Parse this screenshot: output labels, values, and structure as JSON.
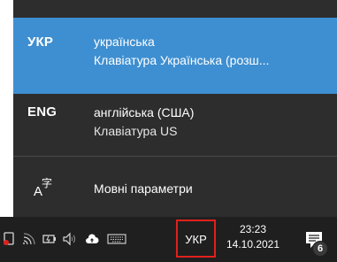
{
  "languages": [
    {
      "code": "УКР",
      "name": "українська",
      "keyboard": "Клавіатура Українська (розш...",
      "selected": true
    },
    {
      "code": "ENG",
      "name": "англійська (США)",
      "keyboard": "Клавіатура US",
      "selected": false
    }
  ],
  "settings": {
    "label": "Мовні параметри",
    "icon": "language-settings-icon"
  },
  "taskbar": {
    "input_indicator": "УКР",
    "time": "23:23",
    "date": "14.10.2021",
    "notification_count": "6",
    "tray_icons": [
      "antivirus-icon",
      "network-icon",
      "battery-icon",
      "volume-icon",
      "cloud-icon",
      "keyboard-icon"
    ]
  },
  "colors": {
    "accent": "#3e8fd1",
    "flyout_bg": "#2d2d2d",
    "taskbar_bg": "#1f1f1f",
    "highlight_border": "#e0201b"
  }
}
